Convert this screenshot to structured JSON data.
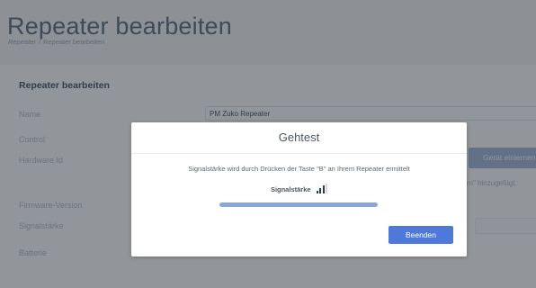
{
  "page": {
    "title": "Repeater bearbeiten",
    "breadcrumb": [
      "Repeater",
      "Repeater bearbeiten"
    ]
  },
  "card": {
    "title": "Repeater bearbeiten",
    "labels": {
      "name": "Name",
      "control": "Control",
      "hardware_id": "Hardware Id",
      "firmware": "Firmware-Version",
      "signal": "Signalstärke",
      "battery": "Batterie"
    },
    "name_value": "PM Zuko Repeater",
    "learn_button": "Gerät einlernen",
    "hint": "hern\" hinzugefügt."
  },
  "modal": {
    "title": "Gehtest",
    "message": "Signalstärke wird durch Drücken der Taste \"B\" an Ihrem Repeater ermittelt",
    "signal_label": "Signalstärke",
    "signal_level": 3,
    "signal_max": 4,
    "progress": 1.0,
    "finish_button": "Beenden"
  },
  "colors": {
    "primary": "#4e79da",
    "overlay": "#262c34"
  }
}
